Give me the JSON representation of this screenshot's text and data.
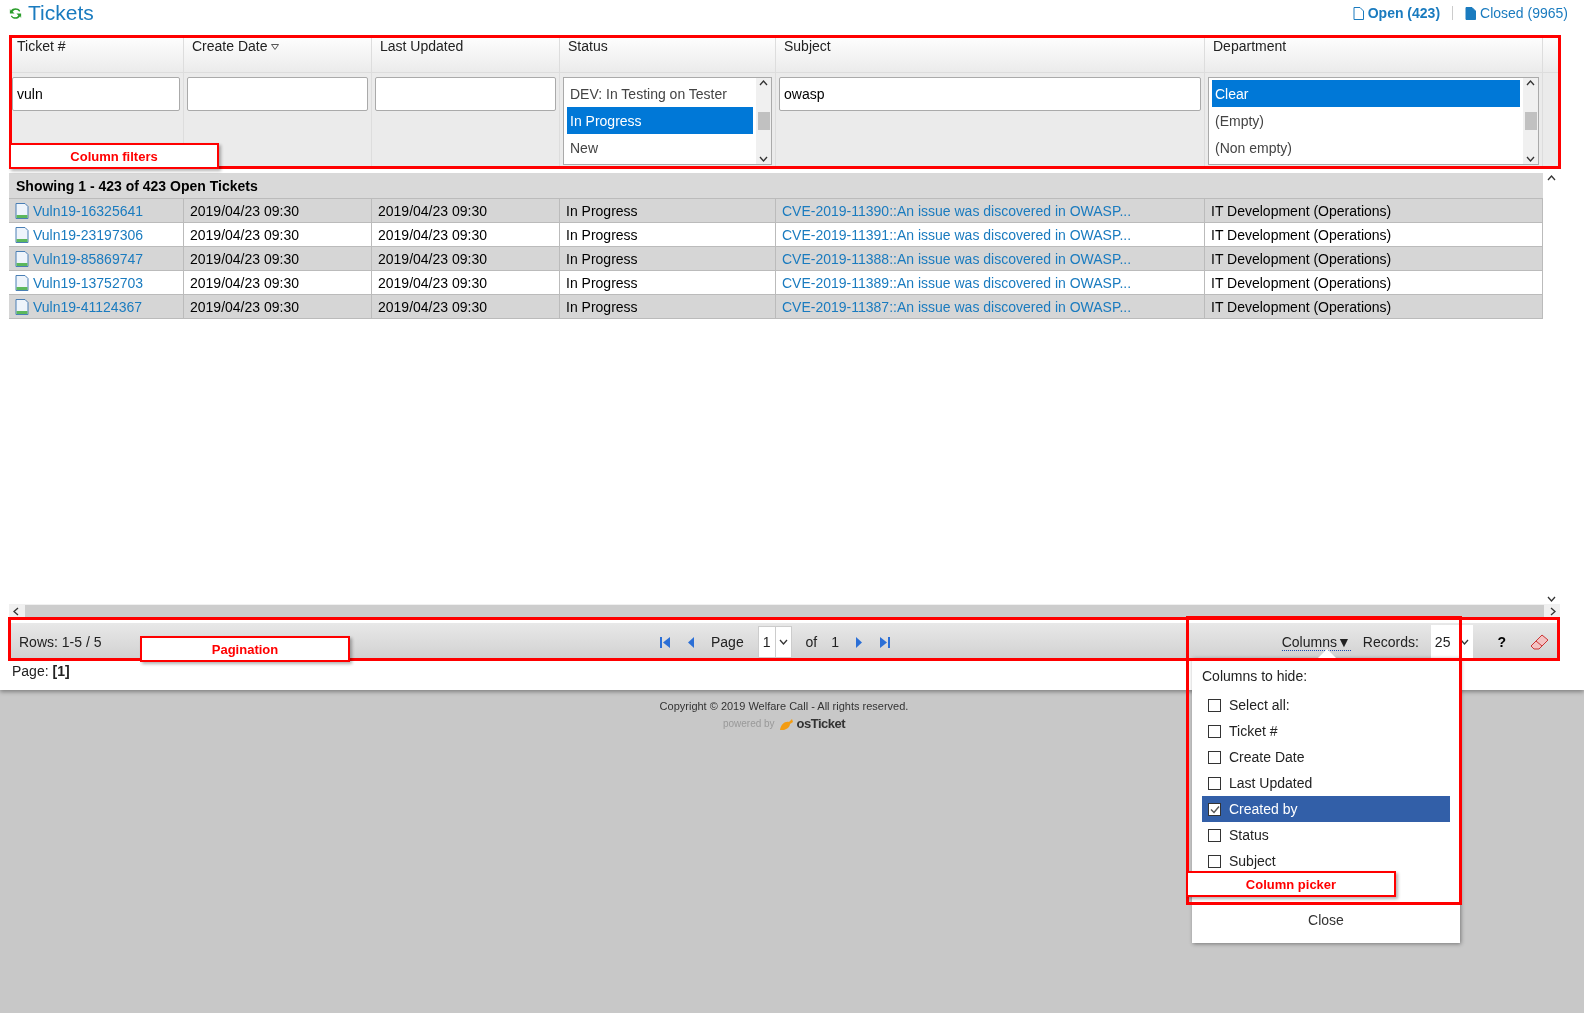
{
  "header": {
    "title": "Tickets",
    "links": [
      {
        "label": "Open (423)",
        "selected": true
      },
      {
        "label": "Closed (9965)",
        "selected": false
      }
    ]
  },
  "columns": [
    {
      "label": "Ticket #",
      "sorted": false
    },
    {
      "label": "Create Date",
      "sorted": true
    },
    {
      "label": "Last Updated",
      "sorted": false
    },
    {
      "label": "Status",
      "sorted": false
    },
    {
      "label": "Subject",
      "sorted": false
    },
    {
      "label": "Department",
      "sorted": false
    }
  ],
  "filters": [
    {
      "kind": "text",
      "value": "vuln"
    },
    {
      "kind": "text"
    },
    {
      "kind": "text"
    },
    {
      "kind": "list",
      "options": [
        {
          "label": "DEV: In Testing on Tester",
          "selected": false
        },
        {
          "label": "In Progress",
          "selected": true
        },
        {
          "label": "New",
          "selected": false
        }
      ]
    },
    {
      "kind": "text",
      "value": "owasp"
    },
    {
      "kind": "list",
      "options": [
        {
          "label": "Clear",
          "selected": true
        },
        {
          "label": "(Empty)",
          "selected": false
        },
        {
          "label": "(Non empty)",
          "selected": false
        }
      ]
    }
  ],
  "caption": "Showing 1 - 423 of 423 Open Tickets",
  "rows": [
    {
      "ticket": "Vuln19-16325641",
      "created": "2019/04/23 09:30",
      "updated": "2019/04/23 09:30",
      "status": "In Progress",
      "subject": "CVE-2019-11390::An issue was discovered in OWASP...",
      "department": "IT Development (Operations)"
    },
    {
      "ticket": "Vuln19-23197306",
      "created": "2019/04/23 09:30",
      "updated": "2019/04/23 09:30",
      "status": "In Progress",
      "subject": "CVE-2019-11391::An issue was discovered in OWASP...",
      "department": "IT Development (Operations)"
    },
    {
      "ticket": "Vuln19-85869747",
      "created": "2019/04/23 09:30",
      "updated": "2019/04/23 09:30",
      "status": "In Progress",
      "subject": "CVE-2019-11388::An issue was discovered in OWASP...",
      "department": "IT Development (Operations)"
    },
    {
      "ticket": "Vuln19-13752703",
      "created": "2019/04/23 09:30",
      "updated": "2019/04/23 09:30",
      "status": "In Progress",
      "subject": "CVE-2019-11389::An issue was discovered in OWASP...",
      "department": "IT Development (Operations)"
    },
    {
      "ticket": "Vuln19-41124367",
      "created": "2019/04/23 09:30",
      "updated": "2019/04/23 09:30",
      "status": "In Progress",
      "subject": "CVE-2019-11387::An issue was discovered in OWASP...",
      "department": "IT Development (Operations)"
    }
  ],
  "pager": {
    "rows_info": "Rows: 1-5 / 5",
    "page_label": "Page",
    "page_value": "1",
    "of_label": "of",
    "page_total": "1",
    "columns_label": "Columns▼",
    "records_label": "Records:",
    "records_value": "25",
    "help": "?"
  },
  "page_summary": "Page: **[1]**",
  "column_picker": {
    "title": "Columns to hide:",
    "items": [
      {
        "label": "Select all:",
        "checked": false,
        "selected": false
      },
      {
        "label": "Ticket #",
        "checked": false,
        "selected": false
      },
      {
        "label": "Create Date",
        "checked": false,
        "selected": false
      },
      {
        "label": "Last Updated",
        "checked": false,
        "selected": false
      },
      {
        "label": "Created by",
        "checked": true,
        "selected": true
      },
      {
        "label": "Status",
        "checked": false,
        "selected": false
      },
      {
        "label": "Subject",
        "checked": false,
        "selected": false
      }
    ],
    "close": "Close"
  },
  "footer": {
    "copyright": "Copyright © 2019 Welfare Call - All rights reserved.",
    "powered_by": "powered by",
    "brand": "osTicket"
  },
  "annotations": [
    {
      "kind": "filters",
      "label": "Column filters"
    },
    {
      "kind": "pagination",
      "label": "Pagination"
    },
    {
      "kind": "picker",
      "label": "Column picker"
    }
  ]
}
